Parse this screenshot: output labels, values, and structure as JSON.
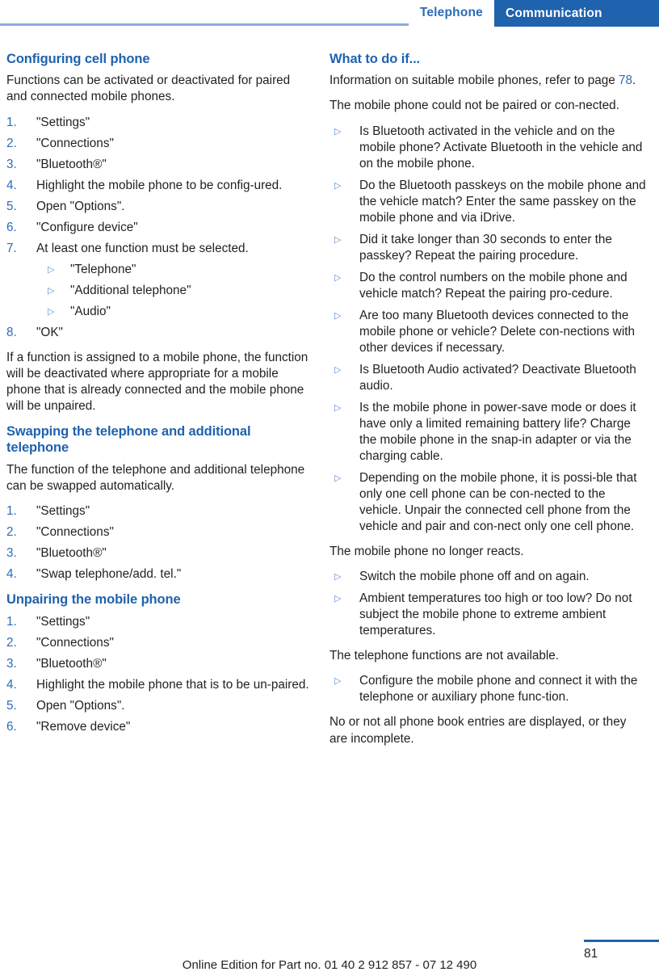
{
  "header": {
    "tab_inactive": "Telephone",
    "tab_active": "Communication",
    "accent_blue": "#1f62ae",
    "light_rule": "#8fa9dd"
  },
  "left_column": {
    "section1": {
      "title": "Configuring cell phone",
      "intro": "Functions can be activated or deactivated for paired and connected mobile phones.",
      "steps": [
        {
          "num": "1.",
          "text": "\"Settings\""
        },
        {
          "num": "2.",
          "text": "\"Connections\""
        },
        {
          "num": "3.",
          "text": "\"Bluetooth®\""
        },
        {
          "num": "4.",
          "text": "Highlight the mobile phone to be config-ured."
        },
        {
          "num": "5.",
          "text": "Open \"Options\"."
        },
        {
          "num": "6.",
          "text": "\"Configure device\""
        },
        {
          "num": "7.",
          "text": "At least one function must be selected."
        }
      ],
      "step7_subitems": [
        "\"Telephone\"",
        "\"Additional telephone\"",
        "\"Audio\""
      ],
      "step8": {
        "num": "8.",
        "text": "\"OK\""
      },
      "closing": "If a function is assigned to a mobile phone, the function will be deactivated where appropriate for a mobile phone that is already connected and the mobile phone will be unpaired."
    },
    "section2": {
      "title": "Swapping the telephone and additional telephone",
      "intro": "The function of the telephone and additional telephone can be swapped automatically.",
      "steps": [
        {
          "num": "1.",
          "text": "\"Settings\""
        },
        {
          "num": "2.",
          "text": "\"Connections\""
        },
        {
          "num": "3.",
          "text": "\"Bluetooth®\""
        },
        {
          "num": "4.",
          "text": "\"Swap telephone/add. tel.\""
        }
      ]
    },
    "section3": {
      "title": "Unpairing the mobile phone",
      "steps": [
        {
          "num": "1.",
          "text": "\"Settings\""
        },
        {
          "num": "2.",
          "text": "\"Connections\""
        },
        {
          "num": "3.",
          "text": "\"Bluetooth®\""
        },
        {
          "num": "4.",
          "text": "Highlight the mobile phone that is to be un-paired."
        },
        {
          "num": "5.",
          "text": "Open \"Options\"."
        },
        {
          "num": "6.",
          "text": "\"Remove device\""
        }
      ]
    }
  },
  "right_column": {
    "title": "What to do if...",
    "intro_prefix": "Information on suitable mobile phones, refer to page ",
    "intro_pageref": "78",
    "intro_suffix": ".",
    "problem1": "The mobile phone could not be paired or con-nected.",
    "problem1_items": [
      "Is Bluetooth activated in the vehicle and on the mobile phone? Activate Bluetooth in the vehicle and on the mobile phone.",
      "Do the Bluetooth passkeys on the mobile phone and the vehicle match? Enter the same passkey on the mobile phone and via iDrive.",
      "Did it take longer than 30 seconds to enter the passkey? Repeat the pairing procedure.",
      "Do the control numbers on the mobile phone and vehicle match? Repeat the pairing pro-cedure.",
      "Are too many Bluetooth devices connected to the mobile phone or vehicle? Delete con-nections with other devices if necessary.",
      "Is Bluetooth Audio activated? Deactivate Bluetooth audio.",
      "Is the mobile phone in power-save mode or does it have only a limited remaining battery life? Charge the mobile phone in the snap-in adapter or via the charging cable.",
      "Depending on the mobile phone, it is possi-ble that only one cell phone can be con-nected to the vehicle. Unpair the connected cell phone from the vehicle and pair and con-nect only one cell phone."
    ],
    "problem2": "The mobile phone no longer reacts.",
    "problem2_items": [
      "Switch the mobile phone off and on again.",
      "Ambient temperatures too high or too low? Do not subject the mobile phone to extreme ambient temperatures."
    ],
    "problem3": "The telephone functions are not available.",
    "problem3_items": [
      "Configure the mobile phone and connect it with the telephone or auxiliary phone func-tion."
    ],
    "problem4": "No or not all phone book entries are displayed, or they are incomplete."
  },
  "footer": {
    "page_number": "81",
    "online_edition": "Online Edition for Part no. 01 40 2 912 857 - 07 12 490"
  },
  "icons": {
    "triangle_bullet": "▷"
  }
}
